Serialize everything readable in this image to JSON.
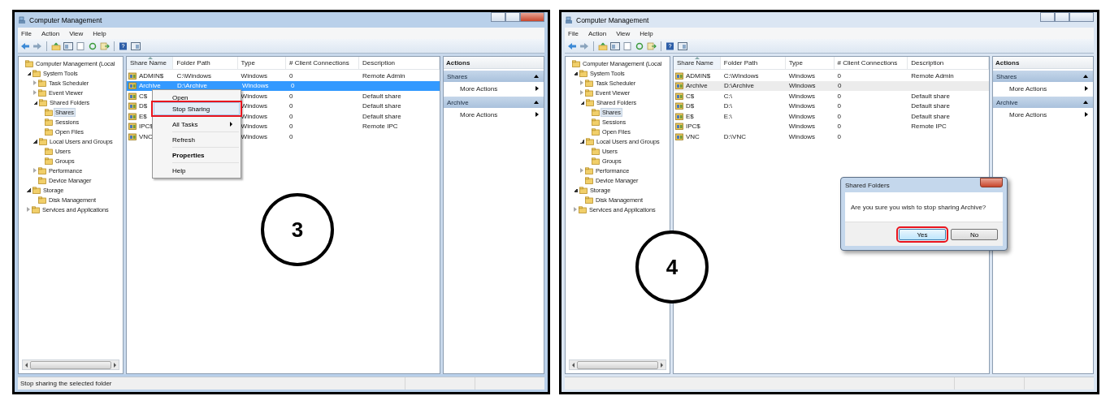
{
  "panels": [
    {
      "step": "3",
      "window": {
        "title": "Computer Management",
        "active": true,
        "menu": [
          "File",
          "Action",
          "View",
          "Help"
        ],
        "tree": [
          {
            "label": "Computer Management (Local",
            "selected": false,
            "children": [
              {
                "label": "System Tools",
                "expanded": true,
                "selected": false,
                "children": [
                  {
                    "label": "Task Scheduler",
                    "expanded": false,
                    "selected": false
                  },
                  {
                    "label": "Event Viewer",
                    "expanded": false,
                    "selected": false
                  },
                  {
                    "label": "Shared Folders",
                    "expanded": true,
                    "selected": false,
                    "children": [
                      {
                        "label": "Shares",
                        "selected": true
                      },
                      {
                        "label": "Sessions",
                        "selected": false
                      },
                      {
                        "label": "Open Files",
                        "selected": false
                      }
                    ]
                  },
                  {
                    "label": "Local Users and Groups",
                    "expanded": true,
                    "selected": false,
                    "children": [
                      {
                        "label": "Users",
                        "selected": false
                      },
                      {
                        "label": "Groups",
                        "selected": false
                      }
                    ]
                  },
                  {
                    "label": "Performance",
                    "expanded": false,
                    "selected": false
                  },
                  {
                    "label": "Device Manager",
                    "selected": false
                  }
                ]
              },
              {
                "label": "Storage",
                "expanded": true,
                "selected": false,
                "children": [
                  {
                    "label": "Disk Management",
                    "selected": false
                  }
                ]
              },
              {
                "label": "Services and Applications",
                "expanded": false,
                "selected": false
              }
            ]
          }
        ],
        "columns": [
          {
            "label": "Share Name",
            "sorted": true
          },
          {
            "label": "Folder Path",
            "sorted": false
          },
          {
            "label": "Type",
            "sorted": false
          },
          {
            "label": "# Client Connections",
            "sorted": false
          },
          {
            "label": "Description",
            "sorted": false
          }
        ],
        "list_focused": true,
        "rows": [
          {
            "cells": [
              "ADMIN$",
              "C:\\Windows",
              "Windows",
              "0",
              "Remote Admin"
            ],
            "selected": false
          },
          {
            "cells": [
              "Archive",
              "D:\\Archive",
              "Windows",
              "0",
              null
            ],
            "selected": true
          },
          {
            "cells": [
              "C$",
              null,
              "Windows",
              "0",
              "Default share"
            ],
            "selected": false
          },
          {
            "cells": [
              "D$",
              null,
              "Windows",
              "0",
              "Default share"
            ],
            "selected": false
          },
          {
            "cells": [
              "E$",
              null,
              "Windows",
              "0",
              "Default share"
            ],
            "selected": false
          },
          {
            "cells": [
              "IPC$",
              null,
              "Windows",
              "0",
              "Remote IPC"
            ],
            "selected": false
          },
          {
            "cells": [
              "VNC",
              null,
              "Windows",
              "0",
              null
            ],
            "selected": false
          }
        ],
        "context_menu": [
          {
            "kind": "item",
            "label": "Open",
            "selected": false,
            "annotated": false
          },
          {
            "kind": "item",
            "label": "Stop Sharing",
            "selected": true,
            "annotated": true
          },
          {
            "kind": "separator"
          },
          {
            "kind": "submenu",
            "label": "All Tasks",
            "selected": false,
            "annotated": false
          },
          {
            "kind": "separator"
          },
          {
            "kind": "item",
            "label": "Refresh",
            "selected": false,
            "annotated": false
          },
          {
            "kind": "separator"
          },
          {
            "kind": "default",
            "label": "Properties",
            "selected": false,
            "annotated": false
          },
          {
            "kind": "separator"
          },
          {
            "kind": "item",
            "label": "Help",
            "selected": false,
            "annotated": false
          }
        ],
        "actions": {
          "title": "Actions",
          "sections": [
            {
              "title": "Shares",
              "items": [
                "More Actions"
              ]
            },
            {
              "title": "Archive",
              "items": [
                "More Actions"
              ]
            }
          ]
        },
        "status_text": "Stop sharing the selected folder"
      }
    },
    {
      "step": "4",
      "window": {
        "title": "Computer Management",
        "active": false,
        "menu": [
          "File",
          "Action",
          "View",
          "Help"
        ],
        "tree": [
          {
            "label": "Computer Management (Local",
            "selected": false,
            "children": [
              {
                "label": "System Tools",
                "expanded": true,
                "selected": false,
                "children": [
                  {
                    "label": "Task Scheduler",
                    "expanded": false,
                    "selected": false
                  },
                  {
                    "label": "Event Viewer",
                    "expanded": false,
                    "selected": false
                  },
                  {
                    "label": "Shared Folders",
                    "expanded": true,
                    "selected": false,
                    "children": [
                      {
                        "label": "Shares",
                        "selected": true
                      },
                      {
                        "label": "Sessions",
                        "selected": false
                      },
                      {
                        "label": "Open Files",
                        "selected": false
                      }
                    ]
                  },
                  {
                    "label": "Local Users and Groups",
                    "expanded": true,
                    "selected": false,
                    "children": [
                      {
                        "label": "Users",
                        "selected": false
                      },
                      {
                        "label": "Groups",
                        "selected": false
                      }
                    ]
                  },
                  {
                    "label": "Performance",
                    "expanded": false,
                    "selected": false
                  },
                  {
                    "label": "Device Manager",
                    "selected": false
                  }
                ]
              },
              {
                "label": "Storage",
                "expanded": true,
                "selected": false,
                "children": [
                  {
                    "label": "Disk Management",
                    "selected": false
                  }
                ]
              },
              {
                "label": "Services and Applications",
                "expanded": false,
                "selected": false
              }
            ]
          }
        ],
        "columns": [
          {
            "label": "Share Name",
            "sorted": true
          },
          {
            "label": "Folder Path",
            "sorted": false
          },
          {
            "label": "Type",
            "sorted": false
          },
          {
            "label": "# Client Connections",
            "sorted": false
          },
          {
            "label": "Description",
            "sorted": false
          }
        ],
        "list_focused": false,
        "rows": [
          {
            "cells": [
              "ADMIN$",
              "C:\\Windows",
              "Windows",
              "0",
              "Remote Admin"
            ],
            "selected": false
          },
          {
            "cells": [
              "Archive",
              "D:\\Archive",
              "Windows",
              "0",
              null
            ],
            "selected": true
          },
          {
            "cells": [
              "C$",
              "C:\\",
              "Windows",
              "0",
              "Default share"
            ],
            "selected": false
          },
          {
            "cells": [
              "D$",
              "D:\\",
              "Windows",
              "0",
              "Default share"
            ],
            "selected": false
          },
          {
            "cells": [
              "E$",
              "E:\\",
              "Windows",
              "0",
              "Default share"
            ],
            "selected": false
          },
          {
            "cells": [
              "IPC$",
              null,
              "Windows",
              "0",
              "Remote IPC"
            ],
            "selected": false
          },
          {
            "cells": [
              "VNC",
              "D:\\VNC",
              "Windows",
              "0",
              null
            ],
            "selected": false
          }
        ],
        "actions": {
          "title": "Actions",
          "sections": [
            {
              "title": "Shares",
              "items": [
                "More Actions"
              ]
            },
            {
              "title": "Archive",
              "items": [
                "More Actions"
              ]
            }
          ]
        },
        "dialog": {
          "title": "Shared Folders",
          "message": "Are you sure you wish to stop sharing Archive?",
          "buttons": [
            {
              "label": "Yes",
              "focused": true,
              "annotated": true
            },
            {
              "label": "No",
              "focused": false,
              "annotated": false
            }
          ]
        }
      }
    }
  ]
}
